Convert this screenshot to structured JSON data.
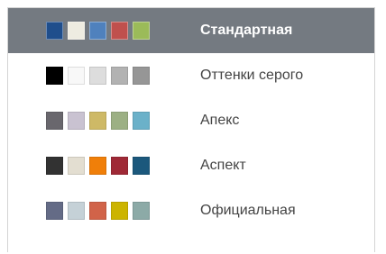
{
  "palettes": [
    {
      "label": "Стандартная",
      "selected": true,
      "colors": [
        "#1f4e8c",
        "#eeece1",
        "#4f81bd",
        "#c0504d",
        "#9bbb59"
      ]
    },
    {
      "label": "Оттенки серого",
      "selected": false,
      "colors": [
        "#000000",
        "#f8f8f8",
        "#dddddd",
        "#b2b2b2",
        "#969696"
      ]
    },
    {
      "label": "Апекс",
      "selected": false,
      "colors": [
        "#69676d",
        "#c9c2d1",
        "#ceb966",
        "#9cb084",
        "#6bb1c9"
      ]
    },
    {
      "label": "Аспект",
      "selected": false,
      "colors": [
        "#323232",
        "#e3ded1",
        "#f07f09",
        "#9f2936",
        "#1b587c"
      ]
    },
    {
      "label": "Официальная",
      "selected": false,
      "colors": [
        "#646b86",
        "#c5d1d7",
        "#d16349",
        "#ccb400",
        "#8caaa7"
      ]
    }
  ]
}
